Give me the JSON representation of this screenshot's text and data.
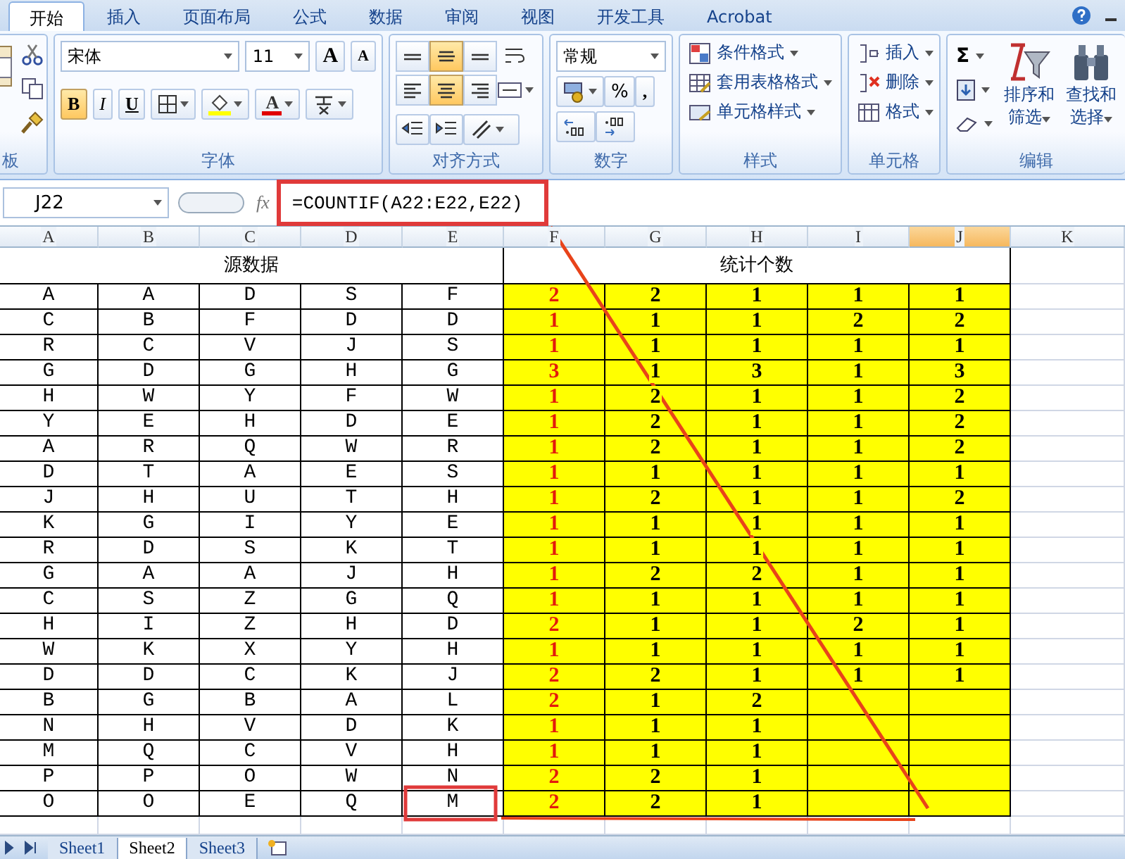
{
  "ribbon_tabs": [
    {
      "label": "开始",
      "selected": true
    },
    {
      "label": "插入",
      "selected": false
    },
    {
      "label": "页面布局",
      "selected": false
    },
    {
      "label": "公式",
      "selected": false
    },
    {
      "label": "数据",
      "selected": false
    },
    {
      "label": "审阅",
      "selected": false
    },
    {
      "label": "视图",
      "selected": false
    },
    {
      "label": "开发工具",
      "selected": false
    },
    {
      "label": "Acrobat",
      "selected": false
    }
  ],
  "clipboard": {
    "label": "板"
  },
  "font": {
    "label": "字体",
    "face": "宋体",
    "size": "11",
    "grow": "A",
    "shrink": "A",
    "color_letter": "A",
    "styles": [
      {
        "label": "B",
        "selected": true
      },
      {
        "label": "I",
        "selected": false
      },
      {
        "label": "U",
        "selected": false
      }
    ]
  },
  "alignment": {
    "label": "对齐方式",
    "buttons": [
      {
        "kind": "top",
        "selected": false
      },
      {
        "kind": "middle",
        "selected": true
      },
      {
        "kind": "bottom",
        "selected": false
      },
      {
        "kind": "left",
        "selected": false
      },
      {
        "kind": "center",
        "selected": true
      },
      {
        "kind": "right",
        "selected": false
      }
    ]
  },
  "number": {
    "label": "数字",
    "format": "常规",
    "percent": "%",
    "comma": ","
  },
  "styles": {
    "label": "样式",
    "items": [
      {
        "kind": "conditional",
        "label": "条件格式"
      },
      {
        "kind": "table",
        "label": "套用表格格式"
      },
      {
        "kind": "cell",
        "label": "单元格样式"
      }
    ]
  },
  "cells": {
    "label": "单元格",
    "items": [
      {
        "kind": "insert",
        "label": "插入"
      },
      {
        "kind": "delete",
        "label": "删除"
      },
      {
        "kind": "format",
        "label": "格式"
      }
    ]
  },
  "editing": {
    "label": "编辑",
    "sum": "Σ",
    "sort": [
      "排序和",
      "筛选"
    ],
    "find": [
      "查找和",
      "选择"
    ]
  },
  "formula_bar": {
    "name_box": "J22",
    "fx": "fx",
    "formula": "=COUNTIF(A22:E22,E22)"
  },
  "columns": [
    {
      "letter": "A",
      "selected": false
    },
    {
      "letter": "B",
      "selected": false
    },
    {
      "letter": "C",
      "selected": false
    },
    {
      "letter": "D",
      "selected": false
    },
    {
      "letter": "E",
      "selected": false
    },
    {
      "letter": "F",
      "selected": false
    },
    {
      "letter": "G",
      "selected": false
    },
    {
      "letter": "H",
      "selected": false
    },
    {
      "letter": "I",
      "selected": false
    },
    {
      "letter": "J",
      "selected": true
    },
    {
      "letter": "K",
      "selected": false
    }
  ],
  "headers": [
    "源数据",
    "统计个数"
  ],
  "rows": [
    {
      "source": [
        "A",
        "A",
        "D",
        "S",
        "F"
      ],
      "counts": [
        "2",
        "2",
        "1",
        "1",
        "1"
      ]
    },
    {
      "source": [
        "C",
        "B",
        "F",
        "D",
        "D"
      ],
      "counts": [
        "1",
        "1",
        "1",
        "2",
        "2"
      ]
    },
    {
      "source": [
        "R",
        "C",
        "V",
        "J",
        "S"
      ],
      "counts": [
        "1",
        "1",
        "1",
        "1",
        "1"
      ]
    },
    {
      "source": [
        "G",
        "D",
        "G",
        "H",
        "G"
      ],
      "counts": [
        "3",
        "1",
        "3",
        "1",
        "3"
      ]
    },
    {
      "source": [
        "H",
        "W",
        "Y",
        "F",
        "W"
      ],
      "counts": [
        "1",
        "2",
        "1",
        "1",
        "2"
      ]
    },
    {
      "source": [
        "Y",
        "E",
        "H",
        "D",
        "E"
      ],
      "counts": [
        "1",
        "2",
        "1",
        "1",
        "2"
      ]
    },
    {
      "source": [
        "A",
        "R",
        "Q",
        "W",
        "R"
      ],
      "counts": [
        "1",
        "2",
        "1",
        "1",
        "2"
      ]
    },
    {
      "source": [
        "D",
        "T",
        "A",
        "E",
        "S"
      ],
      "counts": [
        "1",
        "1",
        "1",
        "1",
        "1"
      ]
    },
    {
      "source": [
        "J",
        "H",
        "U",
        "T",
        "H"
      ],
      "counts": [
        "1",
        "2",
        "1",
        "1",
        "2"
      ]
    },
    {
      "source": [
        "K",
        "G",
        "I",
        "Y",
        "E"
      ],
      "counts": [
        "1",
        "1",
        "1",
        "1",
        "1"
      ]
    },
    {
      "source": [
        "R",
        "D",
        "S",
        "K",
        "T"
      ],
      "counts": [
        "1",
        "1",
        "1",
        "1",
        "1"
      ]
    },
    {
      "source": [
        "G",
        "A",
        "A",
        "J",
        "H"
      ],
      "counts": [
        "1",
        "2",
        "2",
        "1",
        "1"
      ]
    },
    {
      "source": [
        "C",
        "S",
        "Z",
        "G",
        "Q"
      ],
      "counts": [
        "1",
        "1",
        "1",
        "1",
        "1"
      ]
    },
    {
      "source": [
        "H",
        "I",
        "Z",
        "H",
        "D"
      ],
      "counts": [
        "2",
        "1",
        "1",
        "2",
        "1"
      ]
    },
    {
      "source": [
        "W",
        "K",
        "X",
        "Y",
        "H"
      ],
      "counts": [
        "1",
        "1",
        "1",
        "1",
        "1"
      ]
    },
    {
      "source": [
        "D",
        "D",
        "C",
        "K",
        "J"
      ],
      "counts": [
        "2",
        "2",
        "1",
        "1",
        "1"
      ]
    },
    {
      "source": [
        "B",
        "G",
        "B",
        "A",
        "L"
      ],
      "counts": [
        "2",
        "1",
        "2"
      ]
    },
    {
      "source": [
        "N",
        "H",
        "V",
        "D",
        "K"
      ],
      "counts": [
        "1",
        "1",
        "1"
      ]
    },
    {
      "source": [
        "M",
        "Q",
        "C",
        "V",
        "H"
      ],
      "counts": [
        "1",
        "1",
        "1"
      ]
    },
    {
      "source": [
        "P",
        "P",
        "O",
        "W",
        "N"
      ],
      "counts": [
        "2",
        "2",
        "1"
      ]
    },
    {
      "source": [
        "O",
        "O",
        "E",
        "Q",
        "M"
      ],
      "counts": [
        "2",
        "2",
        "1"
      ]
    }
  ],
  "sheet_tabs": [
    {
      "label": "Sheet1",
      "selected": false
    },
    {
      "label": "Sheet2",
      "selected": true
    },
    {
      "label": "Sheet3",
      "selected": false
    }
  ]
}
